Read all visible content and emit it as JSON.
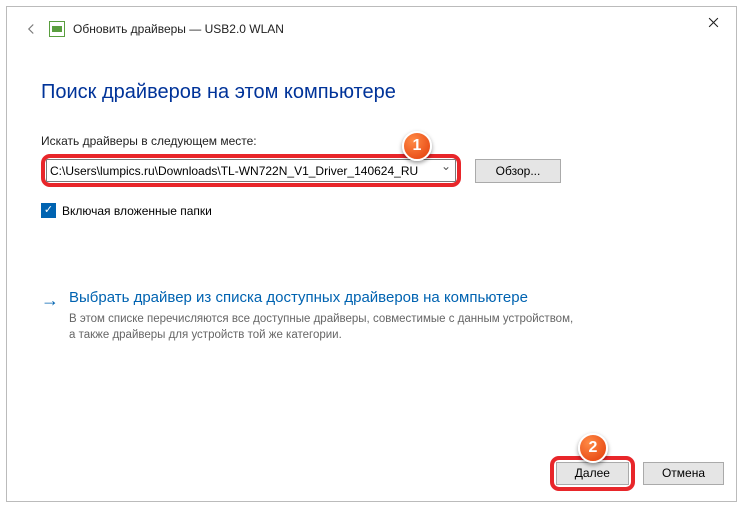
{
  "titlebar": {
    "text": "Обновить драйверы — USB2.0 WLAN"
  },
  "heading": "Поиск драйверов на этом компьютере",
  "search": {
    "label": "Искать драйверы в следующем месте:",
    "path": "C:\\Users\\lumpics.ru\\Downloads\\TL-WN722N_V1_Driver_140624_RU",
    "browse": "Обзор..."
  },
  "include_sub": {
    "label": "Включая вложенные папки",
    "checked": true
  },
  "option": {
    "title": "Выбрать драйвер из списка доступных драйверов на компьютере",
    "desc": "В этом списке перечисляются все доступные драйверы, совместимые с данным устройством, а также драйверы для устройств той же категории."
  },
  "footer": {
    "next": "Далее",
    "cancel": "Отмена"
  },
  "callouts": {
    "one": "1",
    "two": "2"
  }
}
